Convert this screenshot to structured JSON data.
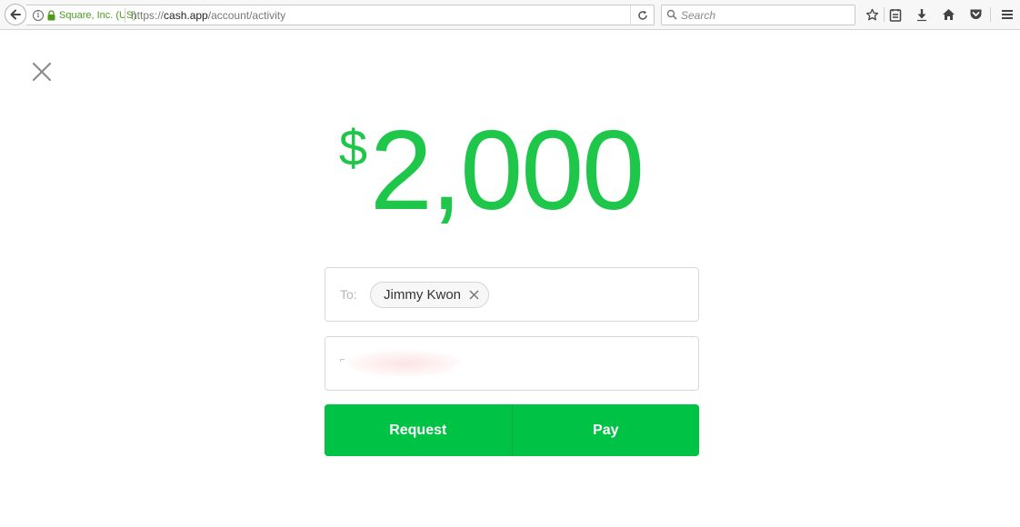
{
  "browser": {
    "site_identity": "Square, Inc. (US)",
    "url_scheme": "https://",
    "url_host": "cash.app",
    "url_path": "/account/activity",
    "search_placeholder": "Search",
    "icons": [
      "back-arrow-icon",
      "info-icon",
      "lock-icon",
      "reload-icon",
      "search-icon",
      "star-icon",
      "reading-list-icon",
      "download-icon",
      "home-icon",
      "pocket-icon",
      "hamburger-menu-icon"
    ]
  },
  "payment": {
    "currency_symbol": "$",
    "amount": "2,000",
    "to_label": "To:",
    "recipient": "Jimmy Kwon",
    "note_value": "",
    "request_label": "Request",
    "pay_label": "Pay",
    "accent_color": "#00c244",
    "amount_color": "#1ec74a"
  }
}
